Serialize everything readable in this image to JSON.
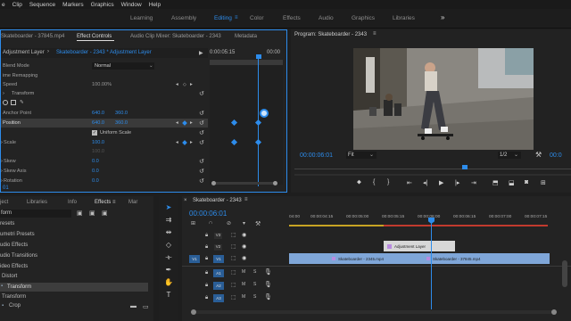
{
  "menu": [
    "e",
    "Clip",
    "Sequence",
    "Markers",
    "Graphics",
    "Window",
    "Help"
  ],
  "workspaces": {
    "tabs": [
      "Learning",
      "Assembly",
      "Editing",
      "Color",
      "Effects",
      "Audio",
      "Graphics",
      "Libraries"
    ],
    "active": "Editing",
    "more": "»"
  },
  "source_panel": {
    "tabs": [
      "Skateboarder - 37845.mp4",
      "Effect Controls",
      "Audio Clip Mixer: Skateboarder - 2343",
      "Metadata"
    ],
    "active_tab": "Effect Controls",
    "clip_header": "Adjustment Layer",
    "clip_path": "Skateboarder - 2343 * Adjustment Layer",
    "mini_timecode": "0:00:05:15",
    "mini_timecode2": "00:00",
    "rows": [
      {
        "label": "Blend Mode",
        "value": "Normal"
      },
      {
        "label": "ime Remapping",
        "value": ""
      },
      {
        "label": "Speed",
        "value": "100.00%"
      },
      {
        "label": "Transform",
        "value": ""
      },
      {
        "label": "",
        "value": ""
      },
      {
        "label": "Anchor Point",
        "value": "640.0",
        "value2": "360.0"
      },
      {
        "label": "Position",
        "value": "640.0",
        "value2": "360.0"
      },
      {
        "label": "",
        "value": "Uniform Scale"
      },
      {
        "label": "Scale",
        "value": "100.0"
      },
      {
        "label": "",
        "value": "100.0"
      },
      {
        "label": "Skew",
        "value": "0.0"
      },
      {
        "label": "Skew Axis",
        "value": "0.0"
      },
      {
        "label": "Rotation",
        "value": "0.0"
      }
    ],
    "bottom_timecode": "01"
  },
  "program": {
    "title": "Program: Skateboarder - 2343",
    "timecode": "00:00:06:01",
    "fit": "Fit",
    "resolution": "1/2",
    "end_timecode": "00:0"
  },
  "project_panel": {
    "tabs": [
      "ject",
      "Libraries",
      "Info",
      "Effects",
      "Mar"
    ],
    "active_tab": "Effects",
    "search": "form",
    "items": [
      "resets",
      "umetri Presets",
      "udio Effects",
      "udio Transitions",
      "ideo Effects",
      "Distort",
      "Transform",
      "Transform",
      "Crop"
    ]
  },
  "timeline": {
    "title": "Skateboarder - 2343",
    "timecode": "00:00:06:01",
    "ruler": [
      "04:00",
      "00:00:04:15",
      "00:00:05:00",
      "00:00:05:15",
      "00:00:06:00",
      "00:00:06:15",
      "00:00:07:00",
      "00:00:07:15"
    ],
    "video_tracks": [
      "V3",
      "V2",
      "V1"
    ],
    "audio_tracks": [
      "A1",
      "A2",
      "A3"
    ],
    "source_patch_video": "V1",
    "source_patch_audio": "A1",
    "clips": {
      "adjustment": "Adjustment Layer",
      "v1_a": "Skateboarder - 2345.mp4",
      "v1_b": "Skateboarder - 37845.mp4"
    }
  },
  "colors": {
    "accent": "#2d8ceb",
    "panel": "#232323",
    "v1_clip": "#7fa6d8",
    "adjustment_clip": "#d7d7d7",
    "adjustment_tag": "#b98be0"
  }
}
